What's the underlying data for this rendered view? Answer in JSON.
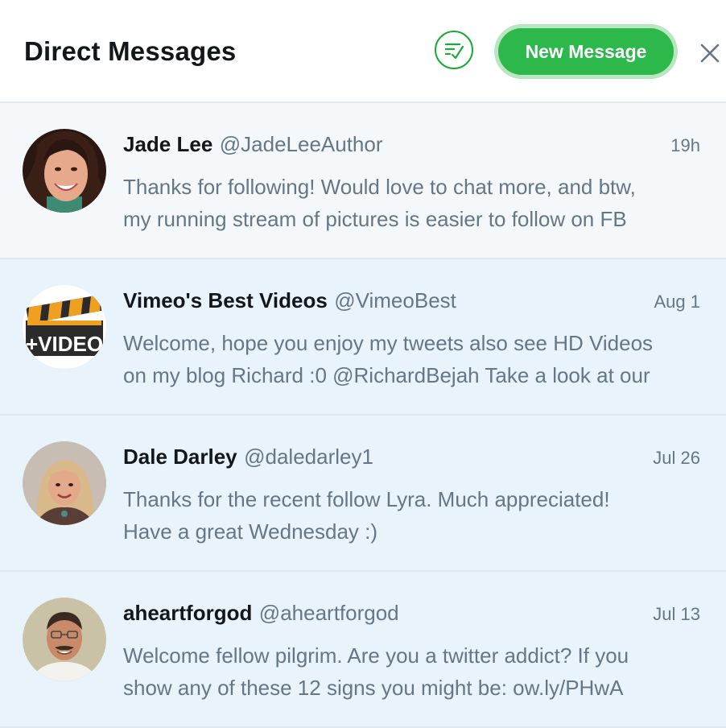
{
  "header": {
    "title": "Direct Messages",
    "new_message_label": "New Message",
    "mark_read_icon": "checkmark-list-icon",
    "close_icon": "close-icon"
  },
  "colors": {
    "accent_green": "#2db84b",
    "unread_bg": "#e8f3fb",
    "read_bg": "#f5f8fa",
    "muted_text": "#657786"
  },
  "conversations": [
    {
      "name": "Jade Lee",
      "handle": "@JadeLeeAuthor",
      "time": "19h",
      "preview_lines": [
        "Thanks for following! Would love to chat more, and btw,",
        "my running stream of pictures is easier to follow on FB"
      ],
      "state": "read"
    },
    {
      "name": "Vimeo's Best Videos",
      "handle": "@VimeoBest",
      "time": "Aug 1",
      "preview_lines": [
        "Welcome, hope you enjoy my tweets also see HD Videos",
        "on my blog Richard :0 @RichardBejah Take a look at our"
      ],
      "avatar_text": "+VIDEO",
      "state": "unread"
    },
    {
      "name": "Dale Darley",
      "handle": "@daledarley1",
      "time": "Jul 26",
      "preview_lines": [
        "Thanks for the recent follow Lyra. Much appreciated!",
        "Have a great Wednesday :)"
      ],
      "state": "unread"
    },
    {
      "name": "aheartforgod",
      "handle": "@aheartforgod",
      "time": "Jul 13",
      "preview_lines": [
        "Welcome fellow pilgrim. Are you a twitter addict? If you",
        "show any of these 12 signs you might be: ow.ly/PHwA"
      ],
      "state": "unread"
    }
  ]
}
